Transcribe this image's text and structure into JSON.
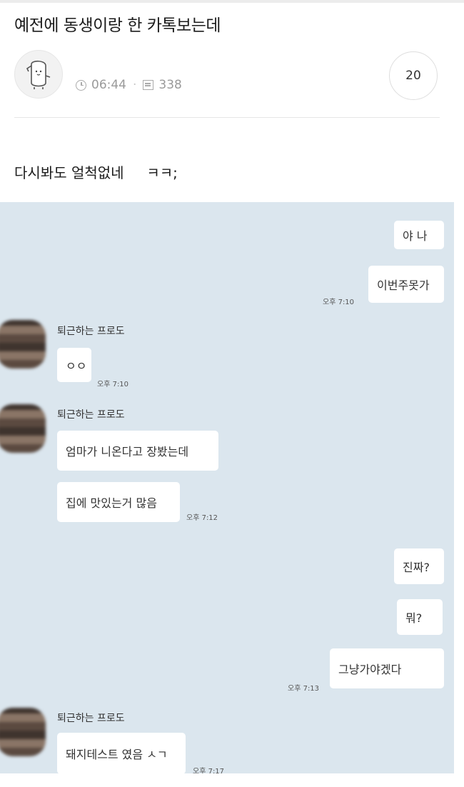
{
  "post": {
    "title": "예전에 동생이랑 한 카톡보는데",
    "time": "06:44",
    "views": "338",
    "comments": "20",
    "body": "다시봐도 얼척없네     ㅋㅋ;"
  },
  "chat": {
    "sender_name": "퇴근하는 프로도",
    "messages": [
      {
        "side": "right",
        "text": "야 나"
      },
      {
        "side": "right",
        "text": "이번주못가",
        "time": "오후 7:10"
      },
      {
        "side": "left",
        "text": "ㅇㅇ",
        "time": "오후 7:10"
      },
      {
        "side": "left",
        "text": "엄마가 니온다고 장봤는데"
      },
      {
        "side": "left",
        "text": "집에 맛있는거 많음",
        "time": "오후 7:12"
      },
      {
        "side": "right",
        "text": "진짜?"
      },
      {
        "side": "right",
        "text": "뭐?"
      },
      {
        "side": "right",
        "text": "그냥가야겠다",
        "time": "오후 7:13"
      },
      {
        "side": "left",
        "text": "돼지테스트 였음 ㅅㄱ",
        "time": "오후 7:17"
      }
    ]
  },
  "colors": {
    "chat_background": "#dbe6ee",
    "bubble": "#ffffff"
  }
}
